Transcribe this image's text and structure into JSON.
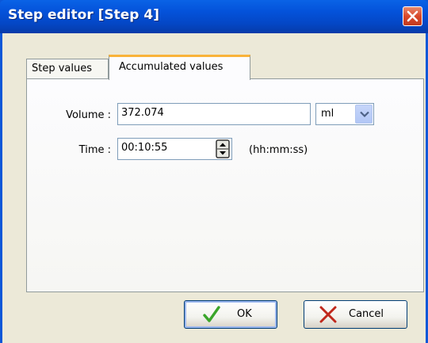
{
  "window": {
    "title": "Step editor [Step 4]"
  },
  "tabs": [
    {
      "label": "Step values",
      "active": false
    },
    {
      "label": "Accumulated values",
      "active": true
    }
  ],
  "volume": {
    "label": "Volume :",
    "value": "372.074",
    "unit": "ml"
  },
  "time": {
    "label": "Time :",
    "value": "00:10:55",
    "format_hint": "(hh:mm:ss)"
  },
  "buttons": {
    "ok_label": "OK",
    "cancel_label": "Cancel"
  },
  "icons": {
    "close": "close-icon",
    "dropdown": "chevron-down-icon",
    "spinner": "spin-updown-icon",
    "ok": "checkmark-icon",
    "cancel": "x-icon"
  },
  "colors": {
    "titlebar": "#0452da",
    "close_button": "#d9482a",
    "active_tab_accent": "#f9b33a",
    "ok_check": "#3aa52a",
    "cancel_x": "#c0281c"
  }
}
